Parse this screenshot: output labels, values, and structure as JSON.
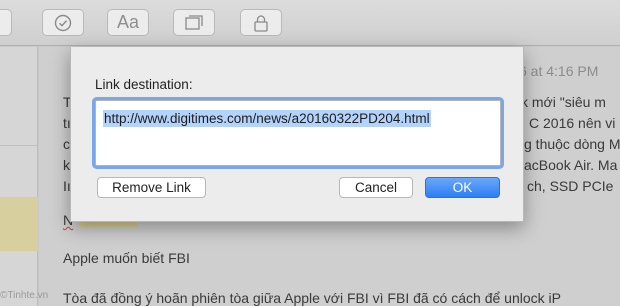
{
  "toolbar": {
    "buttons": [
      {
        "icon": "partial-icon"
      },
      {
        "icon": "checkmark-circle-icon"
      },
      {
        "icon": "text-format-icon",
        "label": "Aa"
      },
      {
        "icon": "gallery-icon"
      },
      {
        "icon": "lock-icon"
      }
    ]
  },
  "note": {
    "date": "6 at 4:16 PM",
    "lines": {
      "l1_left": "T",
      "l1_right": "k mới \"siêu m",
      "l2_left": "tı",
      "l2_right": "C 2016 nên vi",
      "l3_left": "c",
      "l3_right": "g thuộc dòng M",
      "l4_left": "k",
      "l4_right": "acBook Air. Ma",
      "l5_left": "Iı",
      "l5_right": "ch, SSD PCIe",
      "heading_frag": "N",
      "p1": "Apple muốn biết FBI",
      "p2": "Tòa đã đồng ý hoãn phiên tòa giữa Apple với FBI vì FBI đã có cách để unlock iP"
    }
  },
  "dialog": {
    "label": "Link destination:",
    "url": "http://www.digitimes.com/news/a20160322PD204.html",
    "remove_label": "Remove Link",
    "cancel_label": "Cancel",
    "ok_label": "OK"
  },
  "watermark": "©Tinhte.vn"
}
